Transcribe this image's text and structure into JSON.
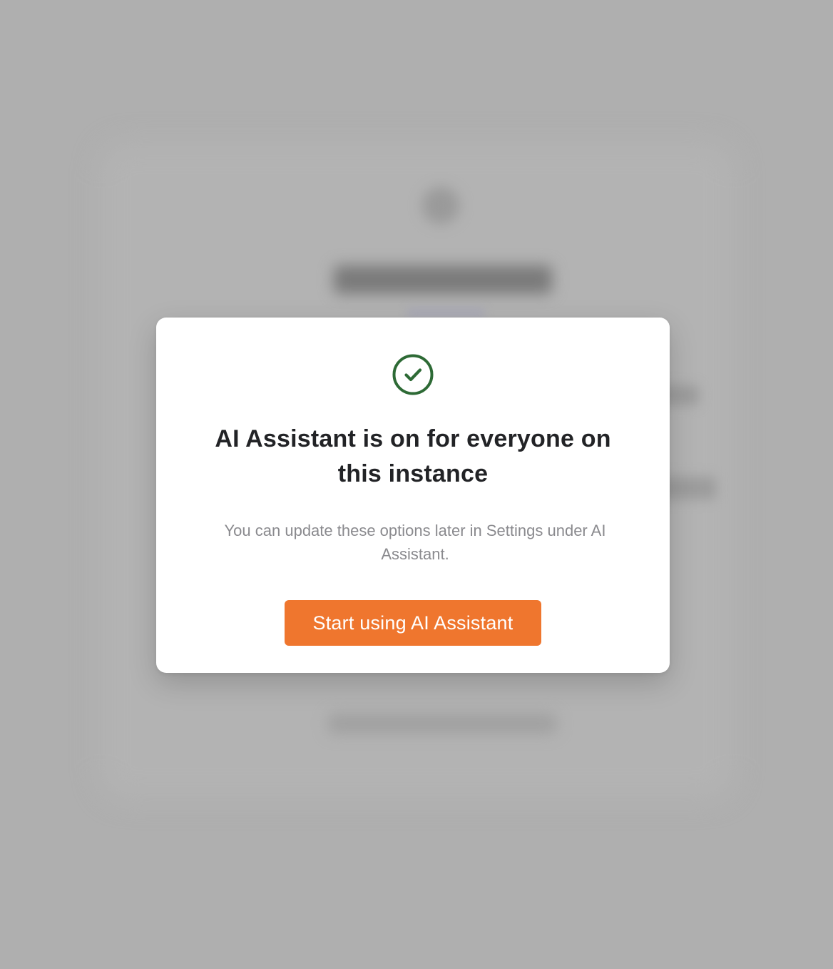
{
  "modal": {
    "title": "AI Assistant is on for everyone on this instance",
    "description": "You can update these options later in Settings under AI Assistant.",
    "primary_button_label": "Start using AI Assistant",
    "icon": "check-circle-icon"
  },
  "colors": {
    "overlay": "#afafaf",
    "modal_background": "#ffffff",
    "success_green": "#2d6a35",
    "primary_button": "#ef762e",
    "title_text": "#222326",
    "description_text": "#8a8a8e"
  }
}
